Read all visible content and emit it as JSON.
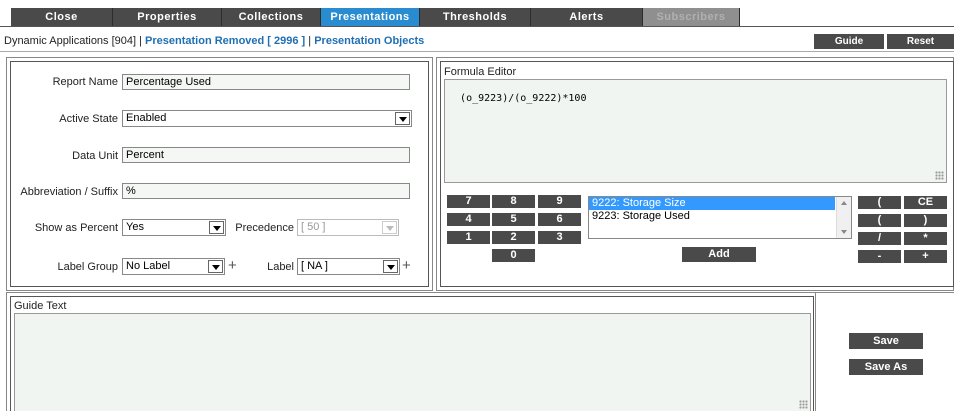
{
  "tabs": [
    {
      "label": "Close",
      "state": "normal"
    },
    {
      "label": "Properties",
      "state": "normal"
    },
    {
      "label": "Collections",
      "state": "normal"
    },
    {
      "label": "Presentations",
      "state": "active"
    },
    {
      "label": "Thresholds",
      "state": "normal"
    },
    {
      "label": "Alerts",
      "state": "normal"
    },
    {
      "label": "Subscribers",
      "state": "disabled"
    }
  ],
  "breadcrumb": {
    "part1": "Dynamic Applications [904] | ",
    "part2": "Presentation Removed [ 2996 ]",
    "sep": " | ",
    "part3": "Presentation Objects"
  },
  "header_buttons": {
    "guide": "Guide",
    "reset": "Reset"
  },
  "form": {
    "report_name": {
      "label": "Report Name",
      "value": "Percentage Used"
    },
    "active_state": {
      "label": "Active State",
      "value": "Enabled"
    },
    "data_unit": {
      "label": "Data Unit",
      "value": "Percent"
    },
    "abbreviation": {
      "label": "Abbreviation / Suffix",
      "value": "%"
    },
    "show_as_percent": {
      "label": "Show as Percent",
      "value": "Yes"
    },
    "precedence": {
      "label": "Precedence",
      "value": "[ 50 ]"
    },
    "label_group": {
      "label": "Label Group",
      "value": "No Label"
    },
    "label": {
      "label": "Label",
      "value": "[ NA ]"
    }
  },
  "formula_editor": {
    "title": "Formula Editor",
    "formula": "(o_9223)/(o_9222)*100",
    "keypad": [
      "7",
      "8",
      "9",
      "4",
      "5",
      "6",
      "1",
      "2",
      "3",
      "0"
    ],
    "objects": [
      "9222: Storage Size",
      "9223: Storage Used"
    ],
    "selected_object_index": 0,
    "add_label": "Add",
    "operators": [
      "(",
      "CE",
      "(",
      ")",
      "/",
      "*",
      "-",
      "+"
    ]
  },
  "guide_text": {
    "title": "Guide Text",
    "value": ""
  },
  "actions": {
    "save": "Save",
    "save_as": "Save As"
  },
  "colors": {
    "tab": "#4a4a4a",
    "tab_active": "#2a8cd0",
    "tab_disabled": "#8f8f8f",
    "link": "#1f6fb3",
    "field_bg": "#f4f7f4",
    "selection": "#3399ff"
  }
}
